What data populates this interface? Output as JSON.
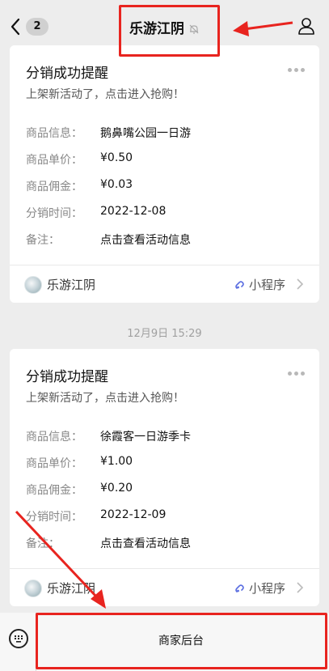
{
  "header": {
    "back_count": "2",
    "title": "乐游江阴"
  },
  "cards": [
    {
      "title": "分销成功提醒",
      "subtitle": "上架新活动了，点击进入抢购！",
      "rows": [
        {
          "key": "商品信息：",
          "value": "鹅鼻嘴公园一日游"
        },
        {
          "key": "商品单价：",
          "value": "¥0.50"
        },
        {
          "key": "商品佣金：",
          "value": "¥0.03"
        },
        {
          "key": "分销时间：",
          "value": "2022-12-08"
        },
        {
          "key": "备注：",
          "value": "点击查看活动信息"
        }
      ],
      "footer_name": "乐游江阴",
      "footer_mini": "小程序"
    },
    {
      "title": "分销成功提醒",
      "subtitle": "上架新活动了，点击进入抢购！",
      "rows": [
        {
          "key": "商品信息：",
          "value": "徐霞客一日游季卡"
        },
        {
          "key": "商品单价：",
          "value": "¥1.00"
        },
        {
          "key": "商品佣金：",
          "value": "¥0.20"
        },
        {
          "key": "分销时间：",
          "value": "2022-12-09"
        },
        {
          "key": "备注：",
          "value": "点击查看活动信息"
        }
      ],
      "footer_name": "乐游江阴",
      "footer_mini": "小程序"
    }
  ],
  "timestamp": "12月9日 15:29",
  "bottom": {
    "menu_label": "商家后台"
  },
  "colors": {
    "annotation": "#e8241f",
    "link_blue": "#5b6ee1"
  }
}
